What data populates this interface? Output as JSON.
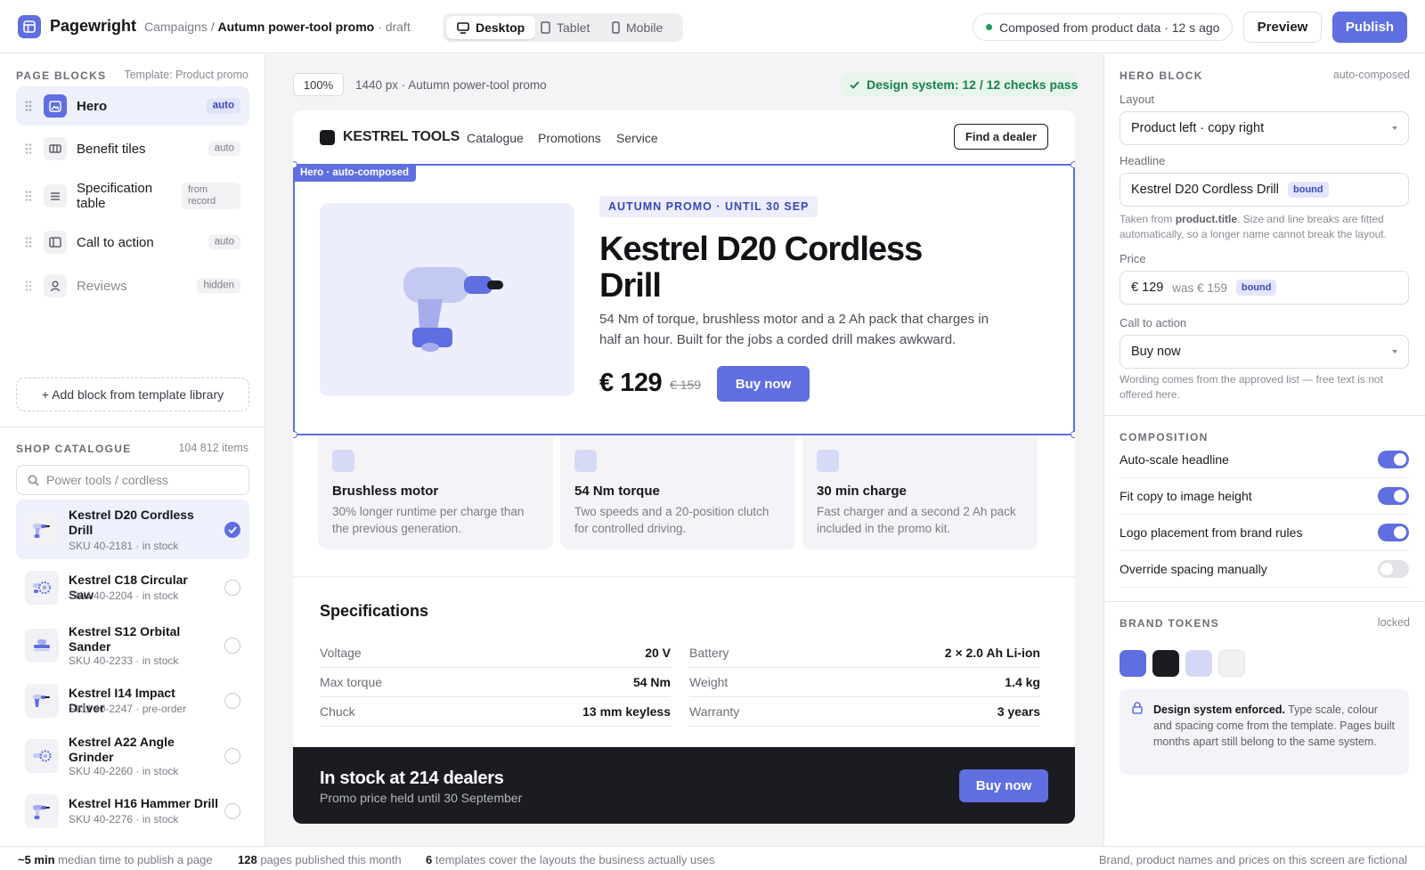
{
  "app": {
    "name": "Pagewright",
    "accent": "#5f6ee0"
  },
  "breadcrumb": {
    "root": "Campaigns /",
    "current": "Autumn power-tool promo",
    "state": "· draft"
  },
  "devices": [
    {
      "label": "Desktop",
      "icon": "desktop-icon",
      "active": true
    },
    {
      "label": "Tablet",
      "icon": "tablet-icon",
      "active": false
    },
    {
      "label": "Mobile",
      "icon": "mobile-icon",
      "active": false
    }
  ],
  "status": "Composed from product data · 12 s ago",
  "actions": {
    "preview": "Preview",
    "publish": "Publish"
  },
  "blocks": {
    "title": "Page blocks",
    "template": "Template: Product promo",
    "items": [
      {
        "label": "Hero",
        "tag": "auto",
        "icon": "image-icon",
        "selected": true
      },
      {
        "label": "Benefit tiles",
        "tag": "auto",
        "icon": "tiles-icon"
      },
      {
        "label": "Specification table",
        "tag": "from record",
        "icon": "list-icon"
      },
      {
        "label": "Call to action",
        "tag": "auto",
        "icon": "panel-icon"
      },
      {
        "label": "Reviews",
        "tag": "hidden",
        "icon": "user-icon",
        "muted": true
      }
    ],
    "add": "+ Add block from template library"
  },
  "catalogue": {
    "title": "Shop catalogue",
    "count": "104 812 items",
    "placeholder": "Power tools / cordless",
    "products": [
      {
        "name": "Kestrel D20 Cordless Drill",
        "sku": "SKU 40-2181 · in stock",
        "icon": "drill-icon",
        "selected": true
      },
      {
        "name": "Kestrel C18 Circular Saw",
        "sku": "SKU 40-2204 · in stock",
        "icon": "saw-icon"
      },
      {
        "name": "Kestrel S12 Orbital Sander",
        "sku": "SKU 40-2233 · in stock",
        "icon": "sander-icon"
      },
      {
        "name": "Kestrel I14 Impact Driver",
        "sku": "SKU 40-2247 · pre-order",
        "icon": "driver-icon"
      },
      {
        "name": "Kestrel A22 Angle Grinder",
        "sku": "SKU 40-2260 · in stock",
        "icon": "grinder-icon"
      },
      {
        "name": "Kestrel H16 Hammer Drill",
        "sku": "SKU 40-2276 · in stock",
        "icon": "hammer-drill-icon"
      }
    ]
  },
  "canvas": {
    "zoom": "100%",
    "meta": "1440 px · Autumn power-tool promo",
    "checks": "Design system: 12 / 12 checks pass"
  },
  "site": {
    "brand": "KESTREL TOOLS",
    "nav": [
      "Catalogue",
      "Promotions",
      "Service"
    ],
    "dealer": "Find a dealer",
    "hero": {
      "tag": "Hero · auto-composed",
      "badge": "AUTUMN PROMO · UNTIL 30 SEP",
      "headline": "Kestrel D20 Cordless Drill",
      "copy": "54 Nm of torque, brushless motor and a 2 Ah pack that charges in half an hour. Built for the jobs a corded drill makes awkward.",
      "price": "€ 129",
      "was": "€ 159",
      "cta": "Buy now"
    },
    "tiles": [
      {
        "title": "Brushless motor",
        "text": "30% longer runtime per charge than the previous generation."
      },
      {
        "title": "54 Nm torque",
        "text": "Two speeds and a 20-position clutch for controlled driving."
      },
      {
        "title": "30 min charge",
        "text": "Fast charger and a second 2 Ah pack included in the promo kit."
      }
    ],
    "specs": {
      "title": "Specifications",
      "rows": [
        {
          "k": "Voltage",
          "v": "20 V"
        },
        {
          "k": "Battery",
          "v": "2 × 2.0 Ah Li-ion"
        },
        {
          "k": "Max torque",
          "v": "54 Nm"
        },
        {
          "k": "Weight",
          "v": "1.4 kg"
        },
        {
          "k": "Chuck",
          "v": "13 mm keyless"
        },
        {
          "k": "Warranty",
          "v": "3 years"
        }
      ]
    },
    "cta_band": {
      "title": "In stock at 214 dealers",
      "sub": "Promo price held until 30 September",
      "button": "Buy now"
    }
  },
  "inspector": {
    "title": "Hero block",
    "mode": "auto-composed",
    "layout_label": "Layout",
    "layout_value": "Product left · copy right",
    "headline_label": "Headline",
    "headline_value": "Kestrel D20 Cordless Drill",
    "bound": "bound",
    "headline_hint_pre": "Taken from ",
    "headline_hint_field": "product.title",
    "headline_hint_post": ". Size and line breaks are fitted automatically, so a longer name cannot break the layout.",
    "price_label": "Price",
    "price_value": "€ 129",
    "price_was": "was € 159",
    "cta_label": "Call to action",
    "cta_value": "Buy now",
    "cta_hint": "Wording comes from the approved list — free text is not offered here.",
    "composition_title": "Composition",
    "toggles": [
      {
        "label": "Auto-scale headline",
        "on": true
      },
      {
        "label": "Fit copy to image height",
        "on": true
      },
      {
        "label": "Logo placement from brand rules",
        "on": true
      },
      {
        "label": "Override spacing manually",
        "on": false
      }
    ],
    "tokens_title": "Brand tokens",
    "tokens_state": "locked",
    "swatches": [
      "#5f6ee0",
      "#1b1c21",
      "#d4d8f5",
      "#f1f1f4"
    ],
    "note_bold": "Design system enforced.",
    "note_text": " Type scale, colour and spacing come from the template. Pages built months apart still belong to the same system."
  },
  "footer": {
    "stat1_value": "~5 min",
    "stat1_label": " median time to publish a page",
    "stat2_value": "128",
    "stat2_label": " pages published this month",
    "stat3_value": "6",
    "stat3_label": " templates cover the layouts the business actually uses",
    "disclaimer": "Brand, product names and prices on this screen are fictional"
  }
}
